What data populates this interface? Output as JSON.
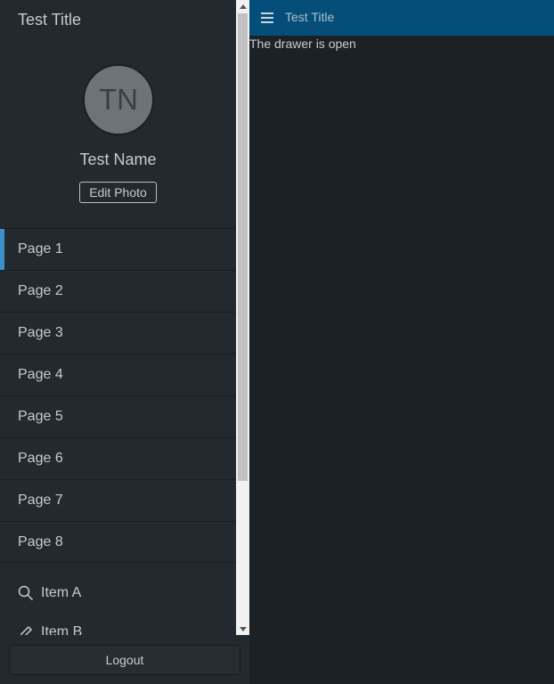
{
  "drawer": {
    "title": "Test Title",
    "avatar_initials": "TN",
    "user_name": "Test Name",
    "edit_photo_label": "Edit Photo",
    "nav_items": [
      {
        "label": "Page 1",
        "active": true
      },
      {
        "label": "Page 2"
      },
      {
        "label": "Page 3"
      },
      {
        "label": "Page 4"
      },
      {
        "label": "Page 5"
      },
      {
        "label": "Page 6"
      },
      {
        "label": "Page 7"
      },
      {
        "label": "Page 8"
      }
    ],
    "extra_items": [
      {
        "label": "Item A",
        "icon": "search-icon"
      },
      {
        "label": "Item B",
        "icon": "pencil-icon"
      }
    ],
    "logout_label": "Logout"
  },
  "topbar": {
    "title": "Test Title"
  },
  "main": {
    "status_text": "The drawer is open"
  },
  "colors": {
    "accent": "#3d8fcc",
    "topbar_bg": "#054e7a",
    "drawer_bg": "#222a2f",
    "content_bg": "#1c2125"
  }
}
